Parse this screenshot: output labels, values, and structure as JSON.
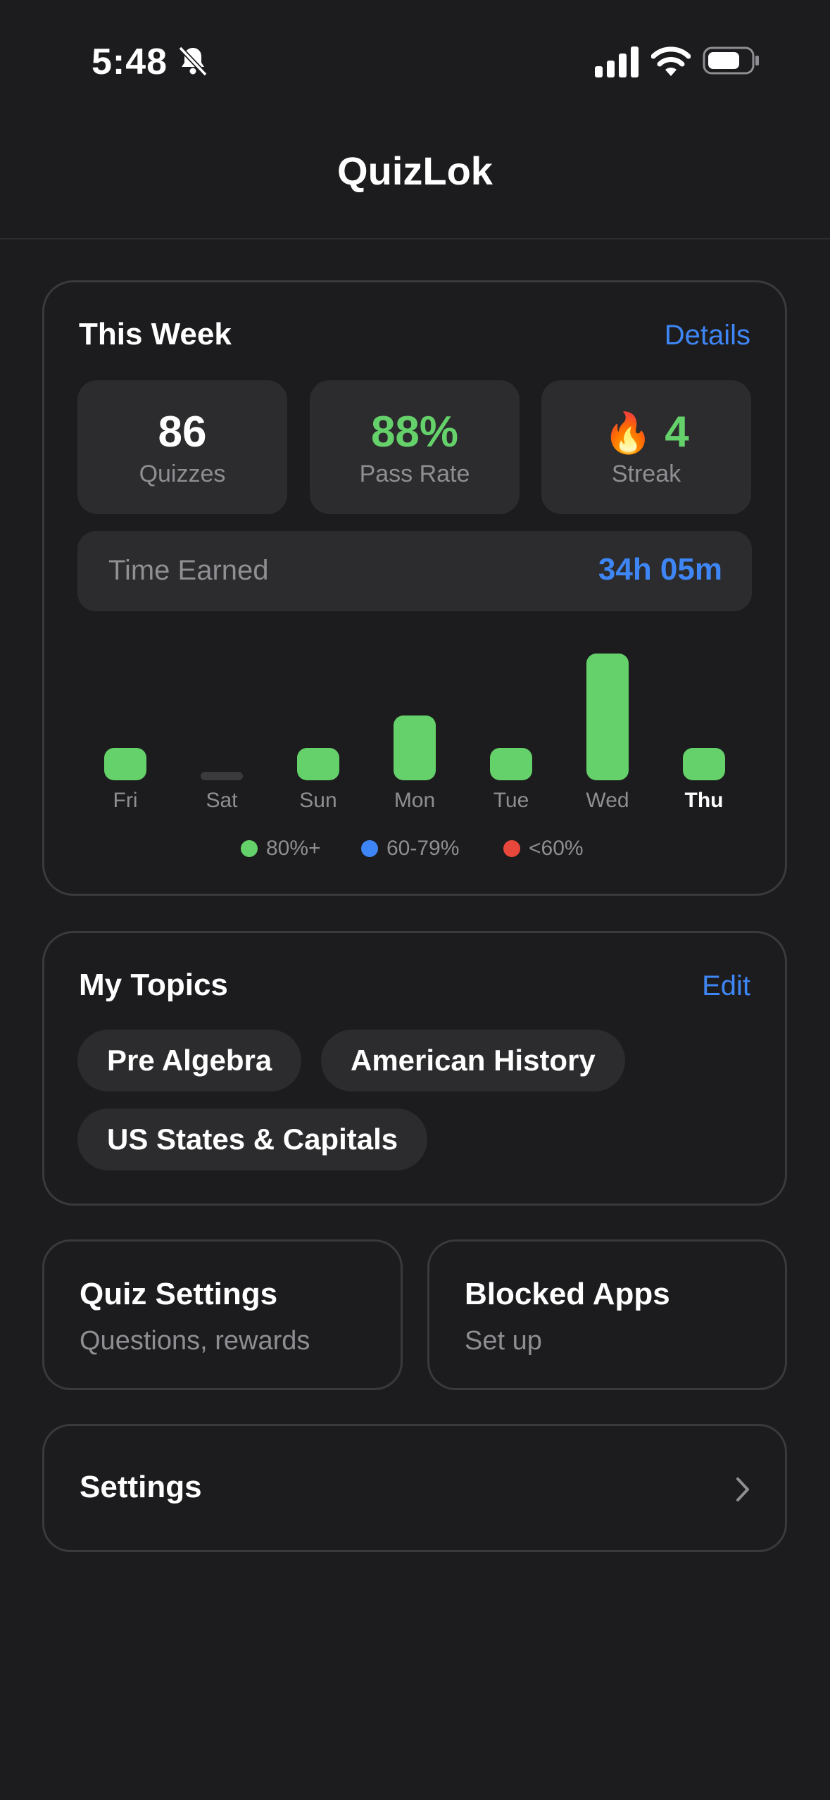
{
  "status": {
    "time": "5:48"
  },
  "app": {
    "title": "QuizLok"
  },
  "week": {
    "title": "This Week",
    "details_label": "Details",
    "stats": [
      {
        "value": "86",
        "label": "Quizzes"
      },
      {
        "value": "88%",
        "label": "Pass Rate"
      },
      {
        "value": "4",
        "label": "Streak",
        "emoji": "🔥"
      }
    ],
    "time_earned": {
      "label": "Time Earned",
      "value": "34h 05m"
    },
    "legend": [
      {
        "label": "80%+",
        "color": "#65d16a"
      },
      {
        "label": "60-79%",
        "color": "#3e86f5"
      },
      {
        "label": "<60%",
        "color": "#e8483b"
      }
    ],
    "chart_data": {
      "type": "bar",
      "categories": [
        "Fri",
        "Sat",
        "Sun",
        "Mon",
        "Tue",
        "Wed",
        "Thu"
      ],
      "values": [
        1,
        0,
        1,
        2,
        1,
        5,
        1
      ],
      "highlight": "Thu"
    }
  },
  "topics": {
    "title": "My Topics",
    "edit_label": "Edit",
    "chips": [
      "Pre Algebra",
      "American History",
      "US States & Capitals"
    ]
  },
  "quiz_settings": {
    "title": "Quiz Settings",
    "subtitle": "Questions, rewards"
  },
  "blocked_apps": {
    "title": "Blocked Apps",
    "subtitle": "Set up"
  },
  "settings": {
    "label": "Settings"
  },
  "colors": {
    "accent": "#3e86f5",
    "success": "#65d16a",
    "danger": "#e8483b"
  }
}
